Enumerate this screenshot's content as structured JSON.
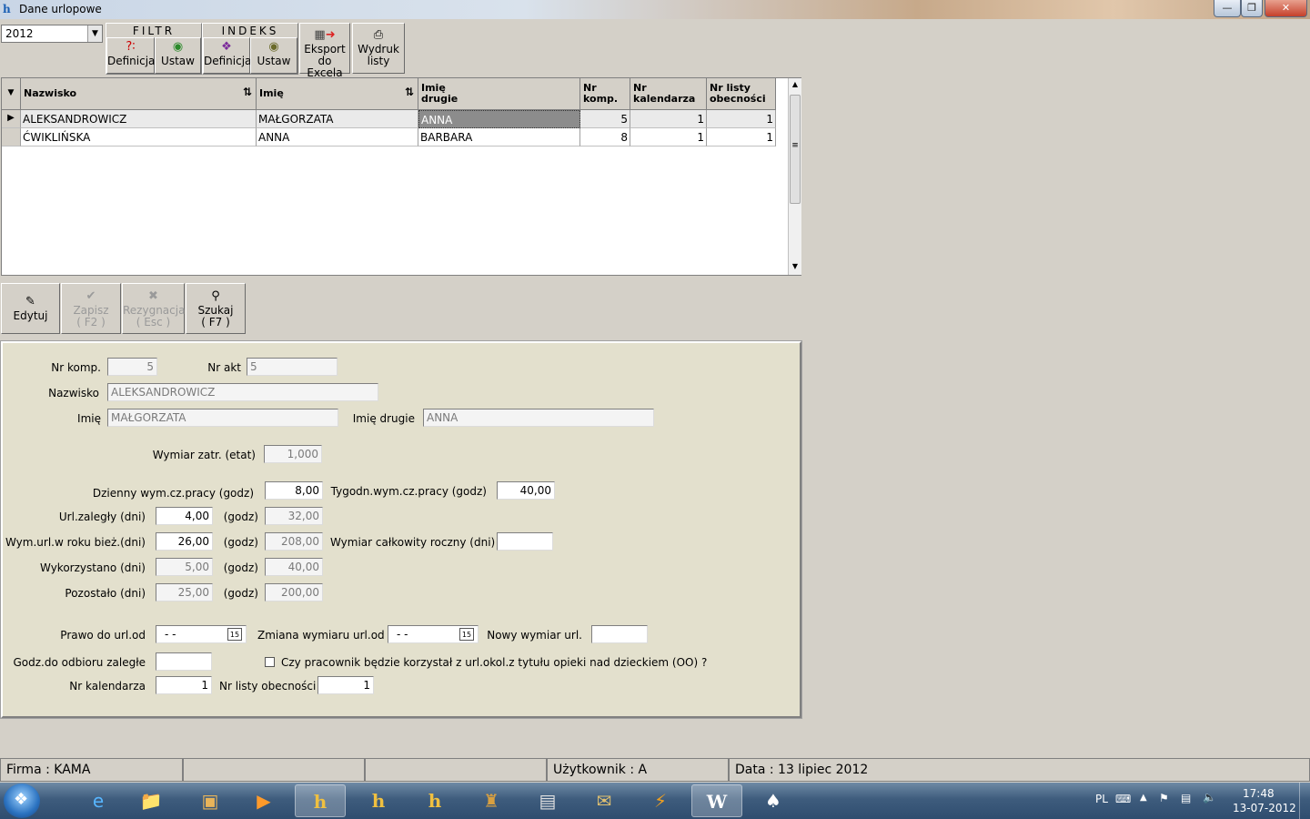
{
  "window": {
    "title": "Dane urlopowe"
  },
  "toolbar": {
    "year": "2012",
    "filtr_label": "FILTR",
    "indeks_label": "INDEKS",
    "filtr_definicja": "Definicja",
    "filtr_ustaw": "Ustaw",
    "indeks_definicja": "Definicja",
    "indeks_ustaw": "Ustaw",
    "eksport_line1": "Eksport",
    "eksport_line2": "do Excela",
    "wydruk_line1": "Wydruk",
    "wydruk_line2": "listy"
  },
  "grid": {
    "columns": [
      {
        "label1": "Nazwisko",
        "label2": ""
      },
      {
        "label1": "Imię",
        "label2": ""
      },
      {
        "label1": "Imię",
        "label2": "drugie"
      },
      {
        "label1": "Nr",
        "label2": "komp."
      },
      {
        "label1": "Nr",
        "label2": "kalendarza"
      },
      {
        "label1": "Nr listy",
        "label2": "obecności"
      }
    ],
    "rows": [
      {
        "nazwisko": "ALEKSANDROWICZ",
        "imie": "MAŁGORZATA",
        "imie2": "ANNA",
        "nrkomp": "5",
        "nrkal": "1",
        "nrlisty": "1"
      },
      {
        "nazwisko": "ĆWIKLIŃSKA",
        "imie": "ANNA",
        "imie2": "BARBARA",
        "nrkomp": "8",
        "nrkal": "1",
        "nrlisty": "1"
      }
    ]
  },
  "actions": {
    "edytuj": "Edytuj",
    "zapisz_line1": "Zapisz",
    "zapisz_line2": "( F2 )",
    "rezygnacja_line1": "Rezygnacja",
    "rezygnacja_line2": "( Esc )",
    "szukaj_line1": "Szukaj",
    "szukaj_line2": "( F7 )"
  },
  "form": {
    "nr_komp_label": "Nr komp.",
    "nr_komp": "5",
    "nr_akt_label": "Nr akt",
    "nr_akt": "5",
    "nazwisko_label": "Nazwisko",
    "nazwisko": "ALEKSANDROWICZ",
    "imie_label": "Imię",
    "imie": "MAŁGORZATA",
    "imie_drugie_label": "Imię drugie",
    "imie_drugie": "ANNA",
    "wymiar_zatr_label": "Wymiar zatr. (etat)",
    "wymiar_zatr": "1,000",
    "dzienny_label": "Dzienny wym.cz.pracy (godz)",
    "dzienny": "8,00",
    "tygodn_label": "Tygodn.wym.cz.pracy (godz)",
    "tygodn": "40,00",
    "url_zalegly_label": "Url.zaległy (dni)",
    "url_zalegly_dni": "4,00",
    "godz_label": "(godz)",
    "url_zalegly_godz": "32,00",
    "wym_url_label": "Wym.url.w roku bież.(dni)",
    "wym_url_dni": "26,00",
    "wym_url_godz": "208,00",
    "wymiar_calk_label": "Wymiar całkowity roczny (dni)",
    "wymiar_calk": "",
    "wykorzystano_label": "Wykorzystano (dni)",
    "wykorzystano_dni": "5,00",
    "wykorzystano_godz": "40,00",
    "pozostalo_label": "Pozostało (dni)",
    "pozostalo_dni": "25,00",
    "pozostalo_godz": "200,00",
    "prawo_label": "Prawo do url.od",
    "prawo_value": "- -",
    "zmiana_label": "Zmiana wymiaru url.od",
    "zmiana_value": "- -",
    "nowy_wymiar_label": "Nowy wymiar url.",
    "nowy_wymiar": "",
    "godz_odbioru_label": "Godz.do odbioru zaległe",
    "godz_odbioru": "",
    "opieka_label": "Czy pracownik będzie korzystał z url.okol.z tytułu opieki nad dzieckiem (OO) ?",
    "nr_kalendarza_label": "Nr kalendarza",
    "nr_kalendarza": "1",
    "nr_listy_label": "Nr listy obecności",
    "nr_listy": "1"
  },
  "statusbar": {
    "firma": "Firma : KAMA",
    "uzytkownik": "Użytkownik : A",
    "data": "Data : 13 lipiec 2012"
  },
  "taskbar": {
    "lang": "PL",
    "time": "17:48",
    "date": "13-07-2012"
  }
}
